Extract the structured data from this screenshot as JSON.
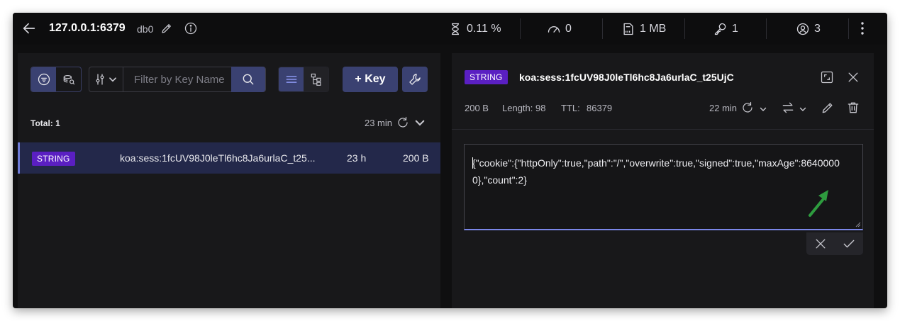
{
  "topbar": {
    "host": "127.0.0.1:6379",
    "db": "db0",
    "stats": {
      "cpu": "0.11 %",
      "ops": "0",
      "memory": "1 MB",
      "keys": "1",
      "clients": "3"
    }
  },
  "keys_panel": {
    "filter_placeholder": "Filter by Key Name",
    "add_key_label": "+ Key",
    "total_label": "Total: 1",
    "refresh_label": "23 min",
    "rows": [
      {
        "type": "STRING",
        "name": "koa:sess:1fcUV98J0leTl6hc8Ja6urlaC_t25...",
        "ttl": "23 h",
        "size": "200 B"
      }
    ]
  },
  "details_panel": {
    "type": "STRING",
    "key_name": "koa:sess:1fcUV98J0leTl6hc8Ja6urlaC_t25UjC",
    "size": "200 B",
    "length_label": "Length: 98",
    "ttl_label": "TTL:",
    "ttl_value": "86379",
    "refresh_label": "22 min",
    "value": "{\"cookie\":{\"httpOnly\":true,\"path\":\"/\",\"overwrite\":true,\"signed\":true,\"maxAge\":86400000},\"count\":2}"
  },
  "colors": {
    "accent": "#3a4171",
    "badge": "#5a1fc2",
    "selected_row": "#23284a",
    "annotation_arrow": "#2e9c3f"
  },
  "icons": [
    "back-arrow-icon",
    "pencil-icon",
    "info-icon",
    "hourglass-icon",
    "gauge-icon",
    "memory-icon",
    "key-icon",
    "user-icon",
    "kebab-icon",
    "filter-icon",
    "database-icon",
    "settings-sliders-icon",
    "chevron-down-icon",
    "search-icon",
    "list-view-icon",
    "tree-view-icon",
    "wrench-icon",
    "refresh-icon",
    "expand-icon",
    "close-icon",
    "convert-icon",
    "trash-icon",
    "check-icon"
  ]
}
